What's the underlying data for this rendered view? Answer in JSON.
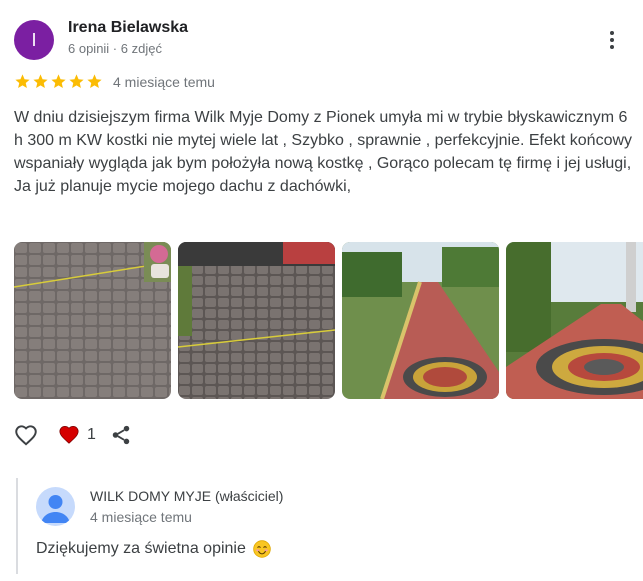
{
  "review": {
    "avatar_letter": "I",
    "author_name": "Irena Bielawska",
    "author_meta": "6 opinii · 6 zdjęć",
    "rating": 5,
    "date": "4 miesiące temu",
    "text": "W dniu dzisiejszym firma Wilk Myje Domy z Pionek umyła mi w trybie błyskawicznym 6 h 300 m KW kostki nie mytej wiele lat , Szybko , sprawnie , perfekcyjnie. Efekt końcowy wspaniały wygląda jak bym położyła nową kostkę , Gorąco polecam tę firmę i jej usługi, Ja już planuje mycie mojego dachu z dachówki,",
    "photos": [
      "dirty-paving-1",
      "dirty-paving-2",
      "clean-path-1",
      "clean-path-2"
    ],
    "like_count": "1"
  },
  "reply": {
    "owner_name": "WILK DOMY MYJE (właściciel)",
    "date": "4 miesiące temu",
    "text": "Dziękujemy za świetna opinie"
  },
  "icons": {
    "more": "more-vert-icon",
    "like": "heart-outline-icon",
    "liked": "heart-filled-icon",
    "share": "share-icon",
    "emoji": "smiling-face-emoji"
  },
  "colors": {
    "avatar": "#7b1fa2",
    "star": "#fbbc04",
    "heart": "#d50000",
    "owner_avatar": "#c6dafc"
  }
}
